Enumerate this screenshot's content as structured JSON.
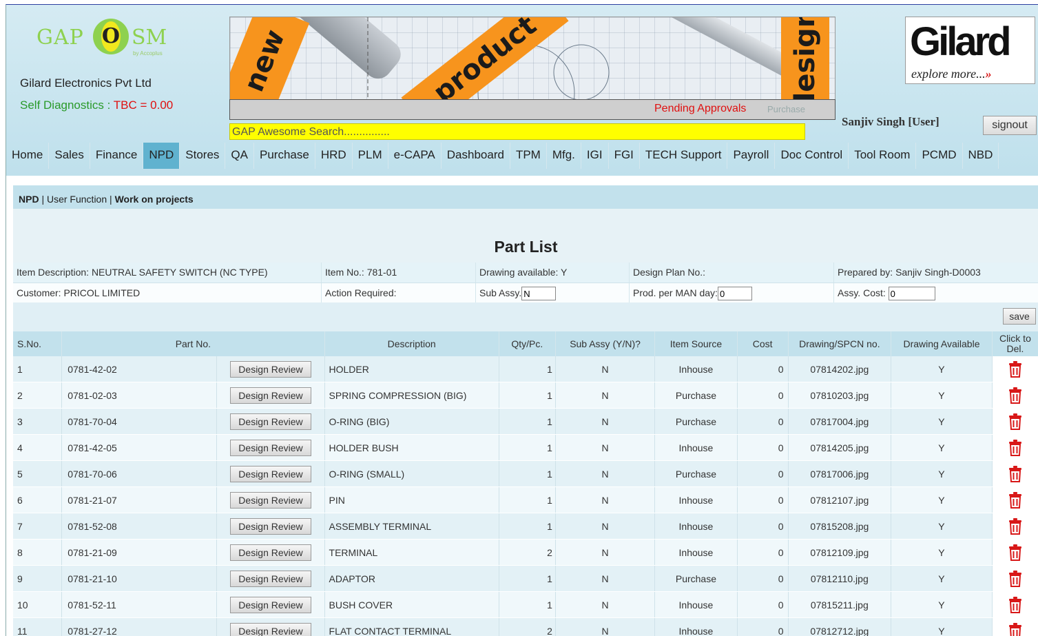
{
  "company": {
    "logo_left": "GAP",
    "logo_o": "O",
    "logo_right": "SM",
    "logo_tag": "by Accoplus",
    "name": "Gilard Electronics Pvt Ltd",
    "self_diag_label": "Self Diagnostics : ",
    "self_diag_value": "TBC = 0.00"
  },
  "banner": {
    "word1": "new",
    "word2": "product",
    "word3": "design",
    "pending": "Pending Approvals",
    "faded": "Purchase"
  },
  "search": {
    "placeholder": "GAP Awesome Search..............."
  },
  "brand": {
    "name": "Gilard",
    "tagline": "explore more...",
    "tagline_arrow": "»"
  },
  "user": {
    "name": "Sanjiv Singh [User]",
    "signout": "signout"
  },
  "nav": [
    "Home",
    "Sales",
    "Finance",
    "NPD",
    "Stores",
    "QA",
    "Purchase",
    "HRD",
    "PLM",
    "e-CAPA",
    "Dashboard",
    "TPM",
    "Mfg.",
    "IGI",
    "FGI",
    "TECH Support",
    "Payroll",
    "Doc Control",
    "Tool Room",
    "PCMD",
    "NBD"
  ],
  "nav_active": "NPD",
  "breadcrumb": {
    "a": "NPD",
    "sep1": " | ",
    "b": "User Function",
    "sep2": " | ",
    "c": "Work on projects"
  },
  "page_title": "Part List",
  "info": {
    "item_desc_label": "Item Description:",
    "item_desc": "NEUTRAL SAFETY SWITCH (NC TYPE)",
    "item_no_label": "Item No.:",
    "item_no": "781-01",
    "drawing_label": "Drawing available:",
    "drawing": "Y",
    "design_plan_label": "Design Plan No.:",
    "design_plan": "",
    "prepared_label": "Prepared by:",
    "prepared": "Sanjiv Singh-D0003",
    "customer_label": "Customer:",
    "customer": "PRICOL LIMITED",
    "action_label": "Action Required:",
    "action": "",
    "sub_assy_label": "Sub Assy.",
    "sub_assy": "N",
    "prod_label": "Prod. per MAN day:",
    "prod": "0",
    "assy_cost_label": "Assy. Cost:",
    "assy_cost": "0"
  },
  "save_label": "save",
  "table": {
    "headers": {
      "sno": "S.No.",
      "part": "Part No.",
      "desc": "Description",
      "qty": "Qty/Pc.",
      "sub": "Sub Assy (Y/N)?",
      "source": "Item Source",
      "cost": "Cost",
      "drawing": "Drawing/SPCN no.",
      "avail": "Drawing Available",
      "del1": "Click to",
      "del2": "Del."
    },
    "button_label": "Design Review",
    "rows": [
      {
        "sno": "1",
        "part": "0781-42-02",
        "desc": "HOLDER",
        "qty": "1",
        "sub": "N",
        "source": "Inhouse",
        "cost": "0",
        "drawing": "07814202.jpg",
        "avail": "Y"
      },
      {
        "sno": "2",
        "part": "0781-02-03",
        "desc": "SPRING COMPRESSION (BIG)",
        "qty": "1",
        "sub": "N",
        "source": "Purchase",
        "cost": "0",
        "drawing": "07810203.jpg",
        "avail": "Y"
      },
      {
        "sno": "3",
        "part": "0781-70-04",
        "desc": "O-RING (BIG)",
        "qty": "1",
        "sub": "N",
        "source": "Purchase",
        "cost": "0",
        "drawing": "07817004.jpg",
        "avail": "Y"
      },
      {
        "sno": "4",
        "part": "0781-42-05",
        "desc": "HOLDER BUSH",
        "qty": "1",
        "sub": "N",
        "source": "Inhouse",
        "cost": "0",
        "drawing": "07814205.jpg",
        "avail": "Y"
      },
      {
        "sno": "5",
        "part": "0781-70-06",
        "desc": "O-RING (SMALL)",
        "qty": "1",
        "sub": "N",
        "source": "Purchase",
        "cost": "0",
        "drawing": "07817006.jpg",
        "avail": "Y"
      },
      {
        "sno": "6",
        "part": "0781-21-07",
        "desc": "PIN",
        "qty": "1",
        "sub": "N",
        "source": "Inhouse",
        "cost": "0",
        "drawing": "07812107.jpg",
        "avail": "Y"
      },
      {
        "sno": "7",
        "part": "0781-52-08",
        "desc": "ASSEMBLY TERMINAL",
        "qty": "1",
        "sub": "N",
        "source": "Inhouse",
        "cost": "0",
        "drawing": "07815208.jpg",
        "avail": "Y"
      },
      {
        "sno": "8",
        "part": "0781-21-09",
        "desc": "TERMINAL",
        "qty": "2",
        "sub": "N",
        "source": "Inhouse",
        "cost": "0",
        "drawing": "07812109.jpg",
        "avail": "Y"
      },
      {
        "sno": "9",
        "part": "0781-21-10",
        "desc": "ADAPTOR",
        "qty": "1",
        "sub": "N",
        "source": "Purchase",
        "cost": "0",
        "drawing": "07812110.jpg",
        "avail": "Y"
      },
      {
        "sno": "10",
        "part": "0781-52-11",
        "desc": "BUSH COVER",
        "qty": "1",
        "sub": "N",
        "source": "Inhouse",
        "cost": "0",
        "drawing": "07815211.jpg",
        "avail": "Y"
      },
      {
        "sno": "11",
        "part": "0781-27-12",
        "desc": "FLAT CONTACT TERMINAL",
        "qty": "2",
        "sub": "N",
        "source": "Inhouse",
        "cost": "0",
        "drawing": "07812712.jpg",
        "avail": "Y"
      }
    ]
  },
  "colors": {
    "nav_active": "#60b2cf",
    "header_bg": "#c2e1ec",
    "alert_red": "#e01010",
    "search_yellow": "#ffff00",
    "brand_orange": "#f7941d"
  },
  "icons": {
    "delete": "trash-icon"
  }
}
